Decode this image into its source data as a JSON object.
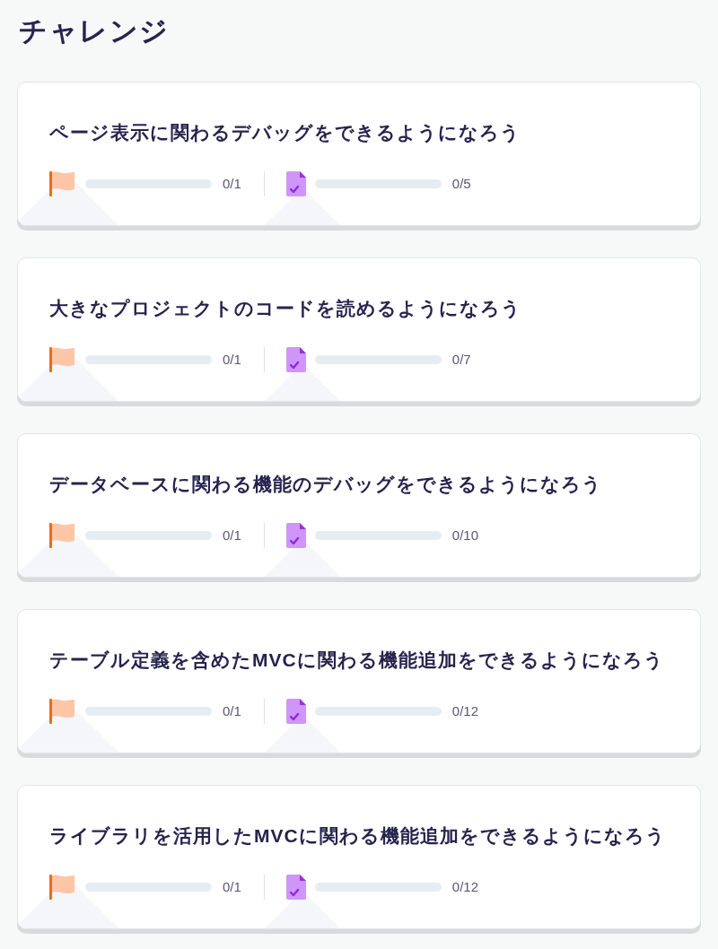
{
  "title": "チャレンジ",
  "challenges": [
    {
      "title": "ページ表示に関わるデバッグをできるようになろう",
      "progress": [
        {
          "kind": "milestone",
          "level": 0,
          "count": "0/1"
        },
        {
          "kind": "task",
          "level": 0,
          "count": "0/5"
        }
      ]
    },
    {
      "title": "大きなプロジェクトのコードを読めるようになろう",
      "progress": [
        {
          "kind": "milestone",
          "level": 0,
          "count": "0/1"
        },
        {
          "kind": "task",
          "level": 0,
          "count": "0/7"
        }
      ]
    },
    {
      "title": "データベースに関わる機能のデバッグをできるようになろう",
      "progress": [
        {
          "kind": "milestone",
          "level": 0,
          "count": "0/1"
        },
        {
          "kind": "task",
          "level": 0,
          "count": "0/10"
        }
      ]
    },
    {
      "title": "テーブル定義を含めたMVCに関わる機能追加をできるようになろう",
      "progress": [
        {
          "kind": "milestone",
          "level": 0,
          "count": "0/1"
        },
        {
          "kind": "task",
          "level": 0,
          "count": "0/12"
        }
      ]
    },
    {
      "title": "ライブラリを活用したMVCに関わる機能追加をできるようになろう",
      "progress": [
        {
          "kind": "milestone",
          "level": 0,
          "count": "0/1"
        },
        {
          "kind": "task",
          "level": 0,
          "count": "0/12"
        }
      ]
    }
  ]
}
